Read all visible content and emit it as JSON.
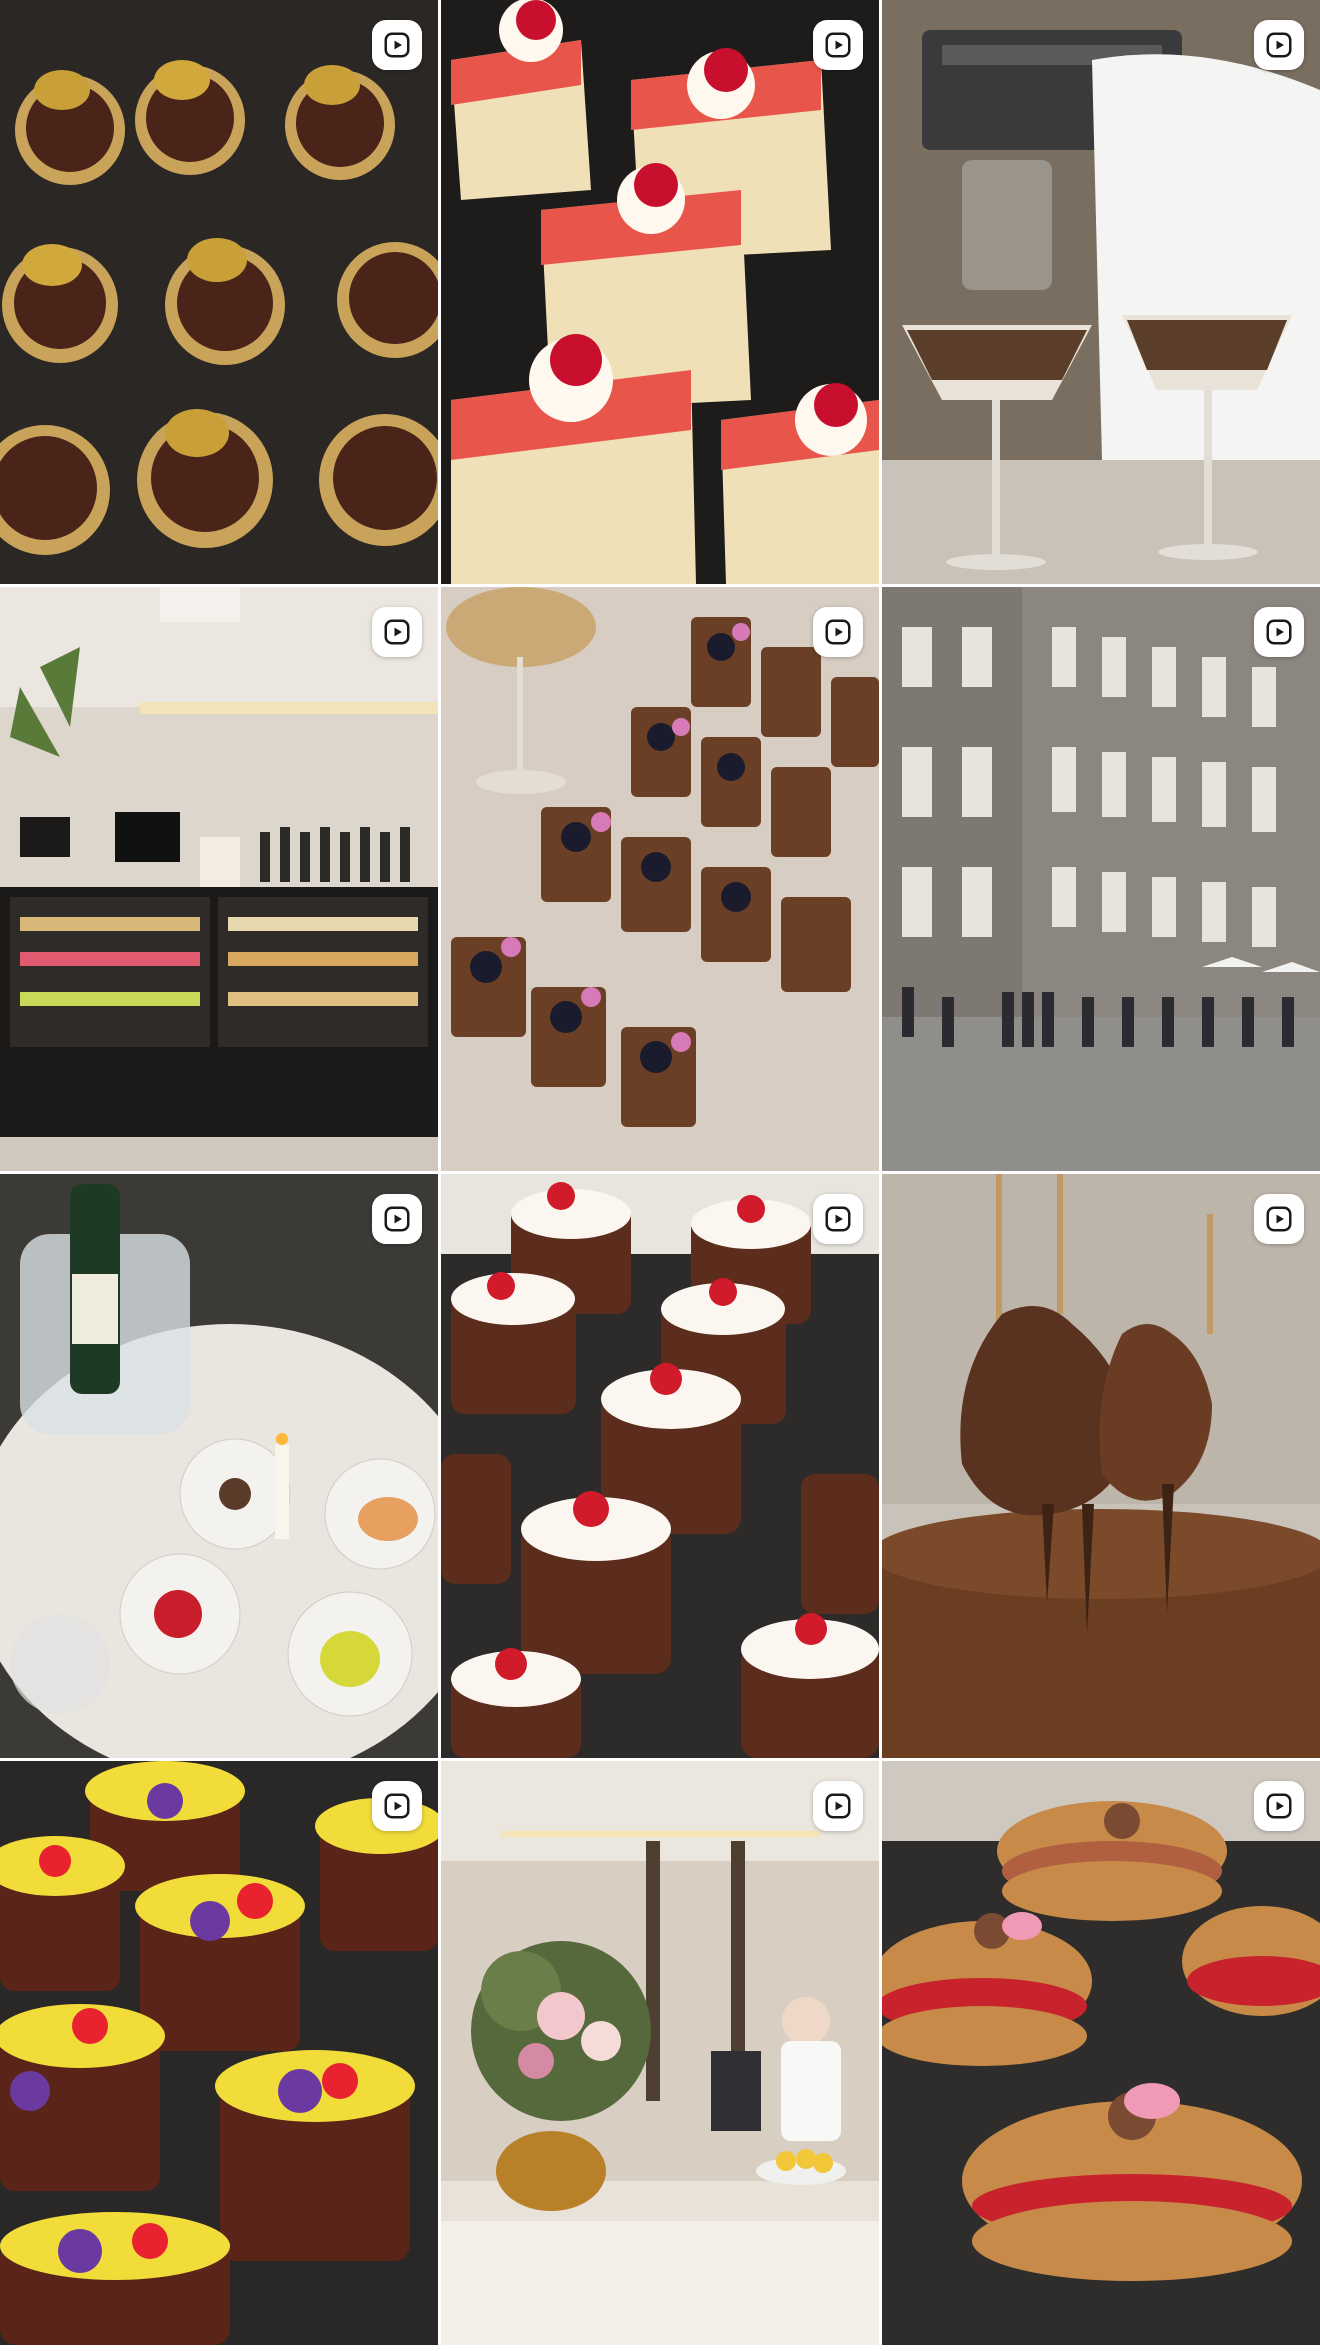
{
  "grid": {
    "tiles": [
      {
        "subject": "macaron-chocolate-tartlets",
        "type": "reel",
        "icon": "play-icon"
      },
      {
        "subject": "raspberry-mousse-cake-slices",
        "type": "reel",
        "icon": "play-icon"
      },
      {
        "subject": "barista-espresso-martinis",
        "type": "reel",
        "icon": "play-icon"
      },
      {
        "subject": "patisserie-display-counter",
        "type": "reel",
        "icon": "play-icon"
      },
      {
        "subject": "chocolate-blackberry-bars",
        "type": "reel",
        "icon": "play-icon"
      },
      {
        "subject": "historic-building-queue",
        "type": "reel",
        "icon": "play-icon"
      },
      {
        "subject": "champagne-dessert-table",
        "type": "reel",
        "icon": "play-icon"
      },
      {
        "subject": "chocolate-cream-cups",
        "type": "reel",
        "icon": "play-icon"
      },
      {
        "subject": "chocolate-dipped-pears",
        "type": "reel",
        "icon": "play-icon"
      },
      {
        "subject": "pansy-chocolate-cakes",
        "type": "reel",
        "icon": "play-icon"
      },
      {
        "subject": "cafe-reception-flowers",
        "type": "reel",
        "icon": "play-icon"
      },
      {
        "subject": "berry-cream-pastries",
        "type": "reel",
        "icon": "play-icon"
      }
    ]
  },
  "colors": {
    "badge_bg": "#ffffff",
    "badge_icon": "#1a1a1a",
    "gap": "#ffffff"
  }
}
